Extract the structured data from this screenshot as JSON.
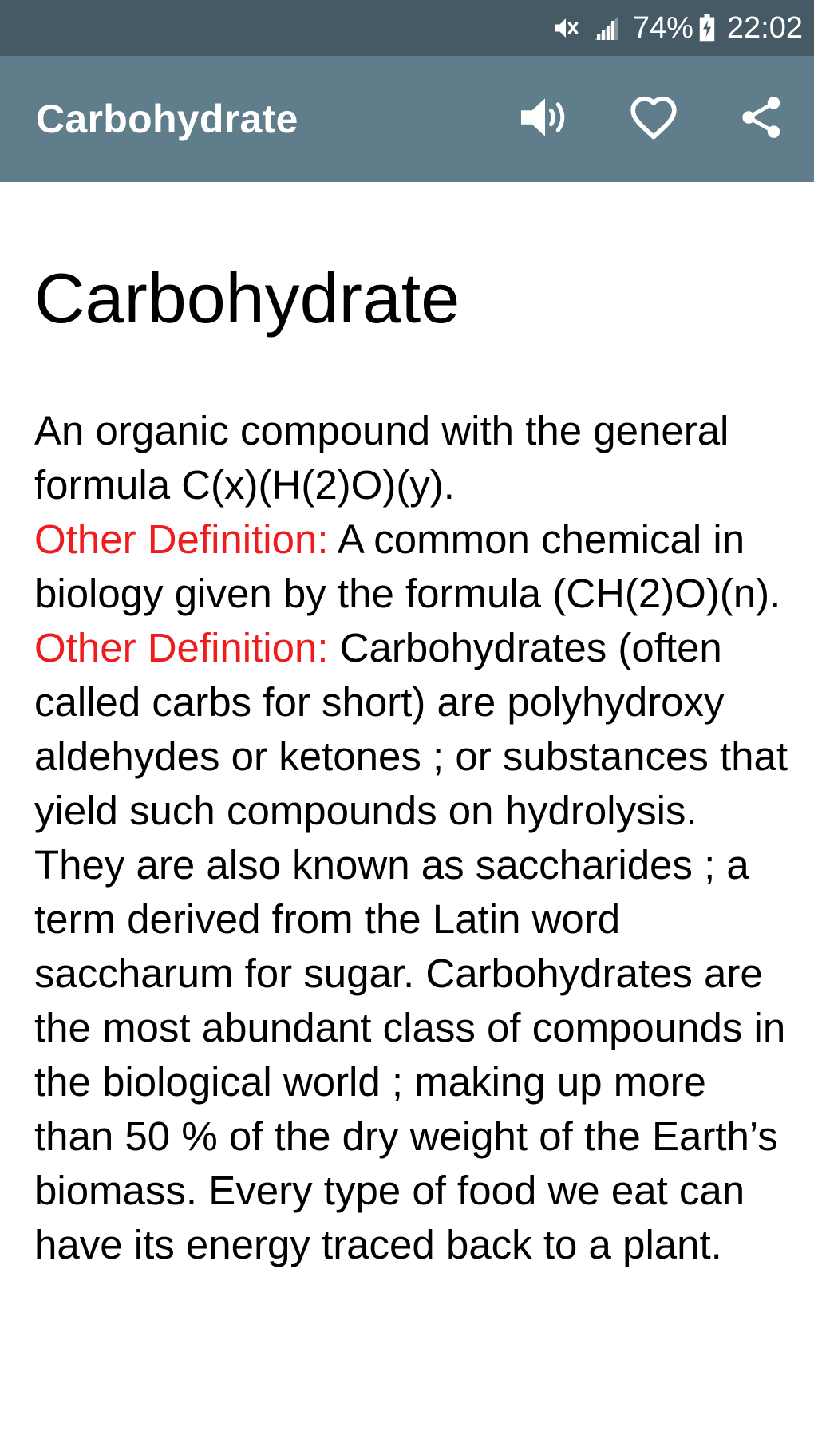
{
  "status_bar": {
    "battery_percent": "74%",
    "time": "22:02",
    "icons": [
      "mute-icon",
      "signal-icon",
      "battery-charging-icon"
    ]
  },
  "app_bar": {
    "title": "Carbohydrate",
    "actions": [
      {
        "name": "speaker-button",
        "icon": "speaker-icon"
      },
      {
        "name": "favorite-button",
        "icon": "heart-icon"
      },
      {
        "name": "share-button",
        "icon": "share-icon"
      }
    ]
  },
  "entry": {
    "title": "Carbohydrate",
    "definition_main": "An organic compound with the general formula C(x)(H(2)O)(y).",
    "other_definitions": [
      {
        "label": "Other Definition:",
        "text": " A common chemical in biology given by the formula (CH(2)O)(n)."
      },
      {
        "label": "Other Definition:",
        "text": " Carbohydrates (often called carbs for short) are polyhydroxy aldehydes or ketones ; or substances that yield such compounds on hydrolysis. They are also known as saccharides ; a term derived from the Latin word saccharum for sugar. Carbohydrates are the most abundant class of compounds in the biological world ; making up more than 50 % of the dry weight of the Earth’s biomass. Every type of food we eat can have its energy traced back to a plant."
      }
    ]
  },
  "colors": {
    "status_bar": "#455a64",
    "app_bar": "#607d8b",
    "definition_label": "#ee1c1c"
  }
}
